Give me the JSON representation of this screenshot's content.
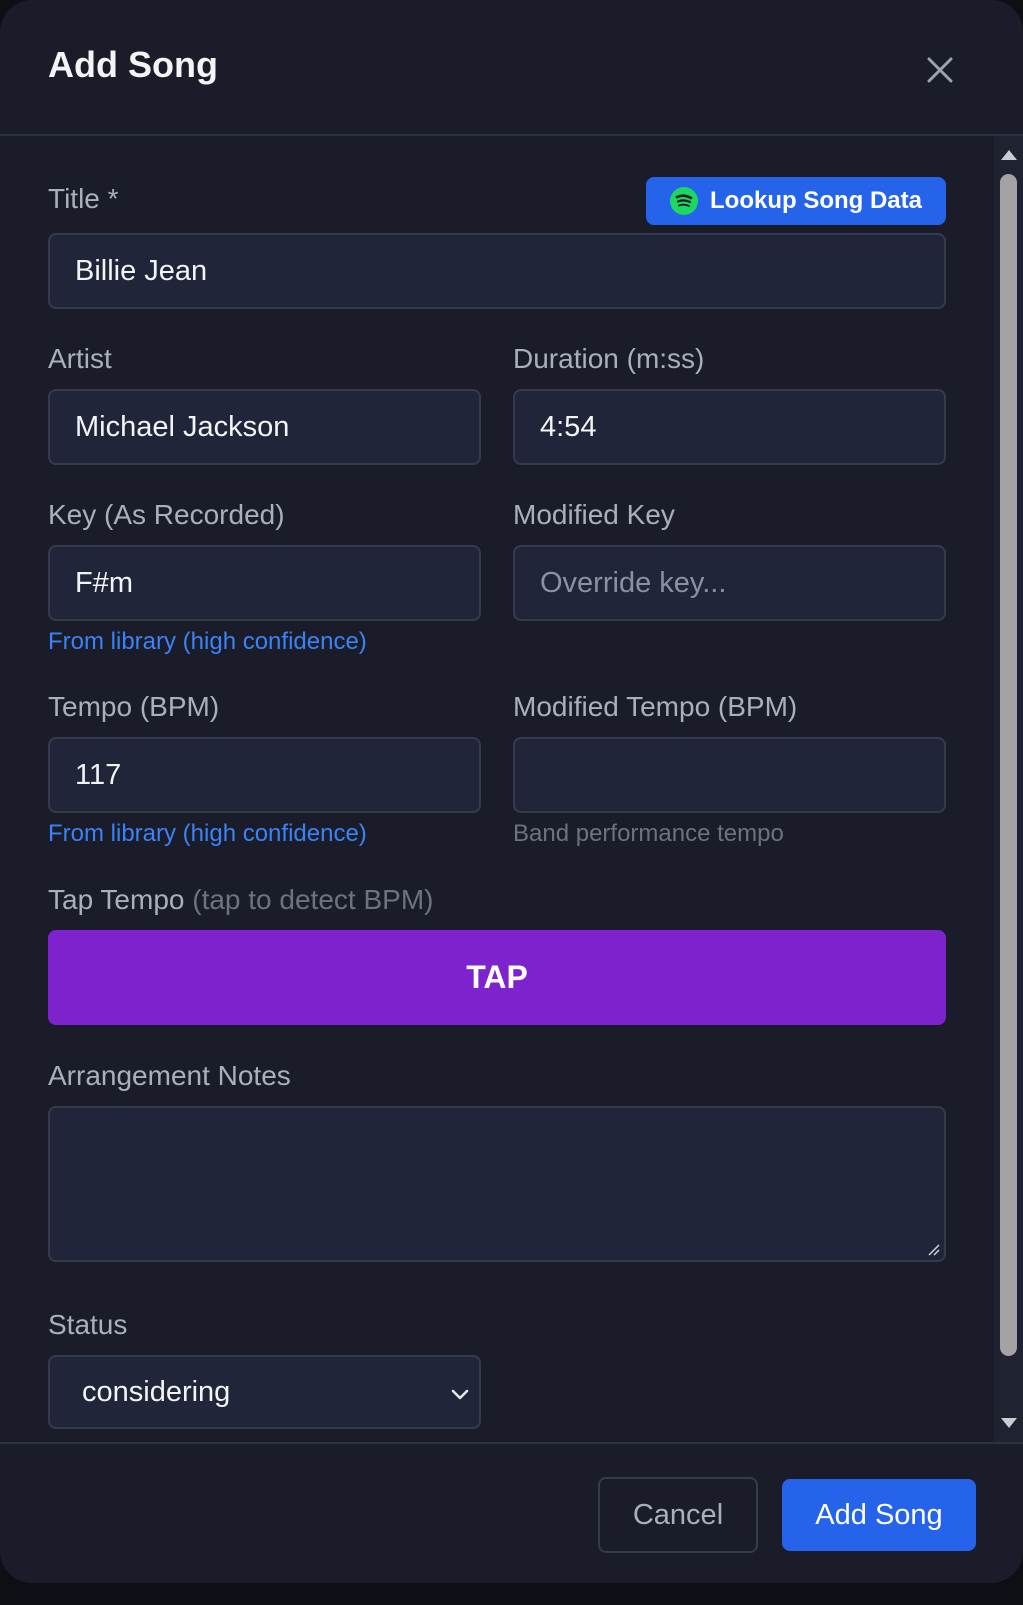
{
  "dialog": {
    "title": "Add Song",
    "close_icon": "close-icon"
  },
  "form": {
    "title": {
      "label": "Title *",
      "value": "Billie Jean"
    },
    "lookup_button": {
      "label": "Lookup Song Data",
      "icon": "spotify-icon",
      "color": "#2563eb"
    },
    "artist": {
      "label": "Artist",
      "value": "Michael Jackson"
    },
    "duration": {
      "label": "Duration (m:ss)",
      "value": "4:54"
    },
    "key": {
      "label": "Key (As Recorded)",
      "value": "F#m",
      "help": "From library (high confidence)"
    },
    "modified_key": {
      "label": "Modified Key",
      "placeholder": "Override key..."
    },
    "tempo": {
      "label": "Tempo (BPM)",
      "value": "117",
      "help": "From library (high confidence)"
    },
    "modified_tempo": {
      "label": "Modified Tempo (BPM)",
      "value": "",
      "help": "Band performance tempo"
    },
    "tap_tempo": {
      "label": "Tap Tempo",
      "hint": "(tap to detect BPM)",
      "button": "TAP",
      "color": "#7e22ce"
    },
    "arrangement_notes": {
      "label": "Arrangement Notes",
      "value": ""
    },
    "status": {
      "label": "Status",
      "value": "considering"
    }
  },
  "footer": {
    "cancel_label": "Cancel",
    "submit_label": "Add Song"
  }
}
